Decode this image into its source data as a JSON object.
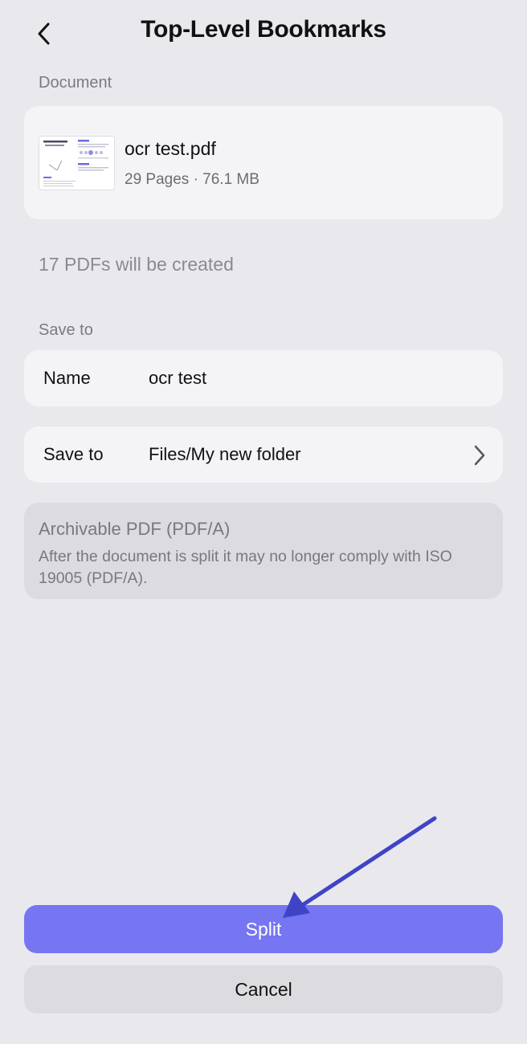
{
  "header": {
    "title": "Top-Level Bookmarks"
  },
  "document_section": {
    "label": "Document",
    "file_name": "ocr test.pdf",
    "file_meta": "29 Pages · 76.1 MB"
  },
  "info": {
    "pdfs_created": "17 PDFs will be created"
  },
  "save_section": {
    "label": "Save to",
    "name_row": {
      "label": "Name",
      "value": "ocr test"
    },
    "location_row": {
      "label": "Save to",
      "value": "Files/My new folder"
    }
  },
  "pdfa_notice": {
    "title": "Archivable PDF (PDF/A)",
    "description": "After the document is split it may no longer comply with ISO 19005 (PDF/A)."
  },
  "actions": {
    "split_label": "Split",
    "cancel_label": "Cancel"
  },
  "colors": {
    "background": "#E9E9ED",
    "accent": "#7675F2",
    "annotation_arrow": "#3F44C7"
  },
  "icons": {
    "back": "chevron-left-icon",
    "disclosure": "chevron-right-icon"
  }
}
